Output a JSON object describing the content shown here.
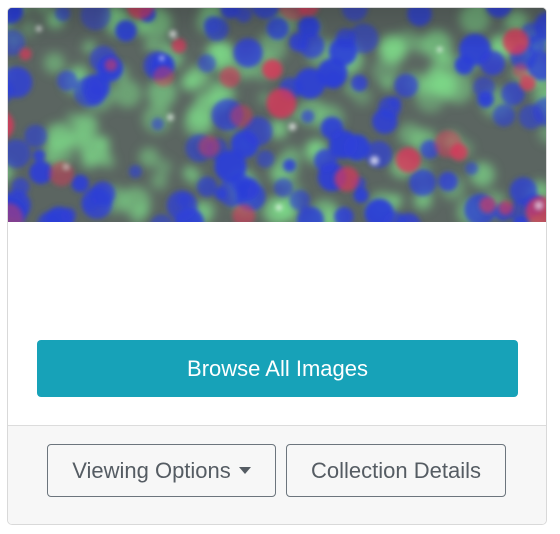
{
  "card": {
    "thumbnail_alt": "",
    "browse_button_label": "Browse All Images",
    "viewing_options_label": "Viewing Options",
    "collection_details_label": "Collection Details"
  },
  "colors": {
    "primary": "#17a2b8",
    "outline": "#6c757d",
    "footer_bg": "#f7f7f7",
    "cell_blue": "#2d3fd8",
    "cell_green": "#7fe08a",
    "cell_red": "#d8385a"
  },
  "icons": {
    "dropdown": "caret-down-icon"
  }
}
